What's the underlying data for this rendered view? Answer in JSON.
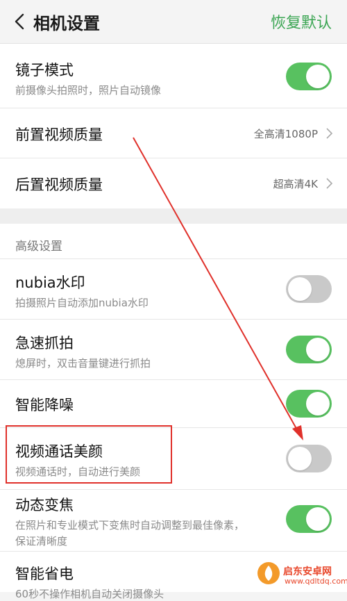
{
  "header": {
    "title": "相机设置",
    "restore_label": "恢复默认"
  },
  "settings": {
    "mirror": {
      "title": "镜子模式",
      "subtitle": "前摄像头拍照时，照片自动镜像",
      "on": true
    },
    "front_video": {
      "title": "前置视频质量",
      "value": "全高清1080P"
    },
    "rear_video": {
      "title": "后置视频质量",
      "value": "超高清4K"
    }
  },
  "advanced": {
    "header": "高级设置",
    "nubia_watermark": {
      "title": "nubia水印",
      "subtitle": "拍摄照片自动添加nubia水印",
      "on": false
    },
    "quick_snap": {
      "title": "急速抓拍",
      "subtitle": "熄屏时，双击音量键进行抓拍",
      "on": true
    },
    "noise_reduction": {
      "title": "智能降噪",
      "on": true
    },
    "video_beauty": {
      "title": "视频通话美颜",
      "subtitle": "视频通话时，自动进行美颜",
      "on": false
    },
    "dynamic_zoom": {
      "title": "动态变焦",
      "subtitle_line1": "在照片和专业模式下变焦时自动调整到最佳像素，",
      "subtitle_line2": "保证清晰度",
      "on": true
    },
    "power_save": {
      "title": "智能省电",
      "subtitle": "60秒不操作相机自动关闭摄像头"
    }
  },
  "watermark": {
    "title": "启东安卓网",
    "url": "www.qdltdq.com"
  },
  "colors": {
    "accent": "#3aa552",
    "toggle_on": "#58c160",
    "toggle_off": "#c9c9c9",
    "annotation": "#e0302a"
  }
}
